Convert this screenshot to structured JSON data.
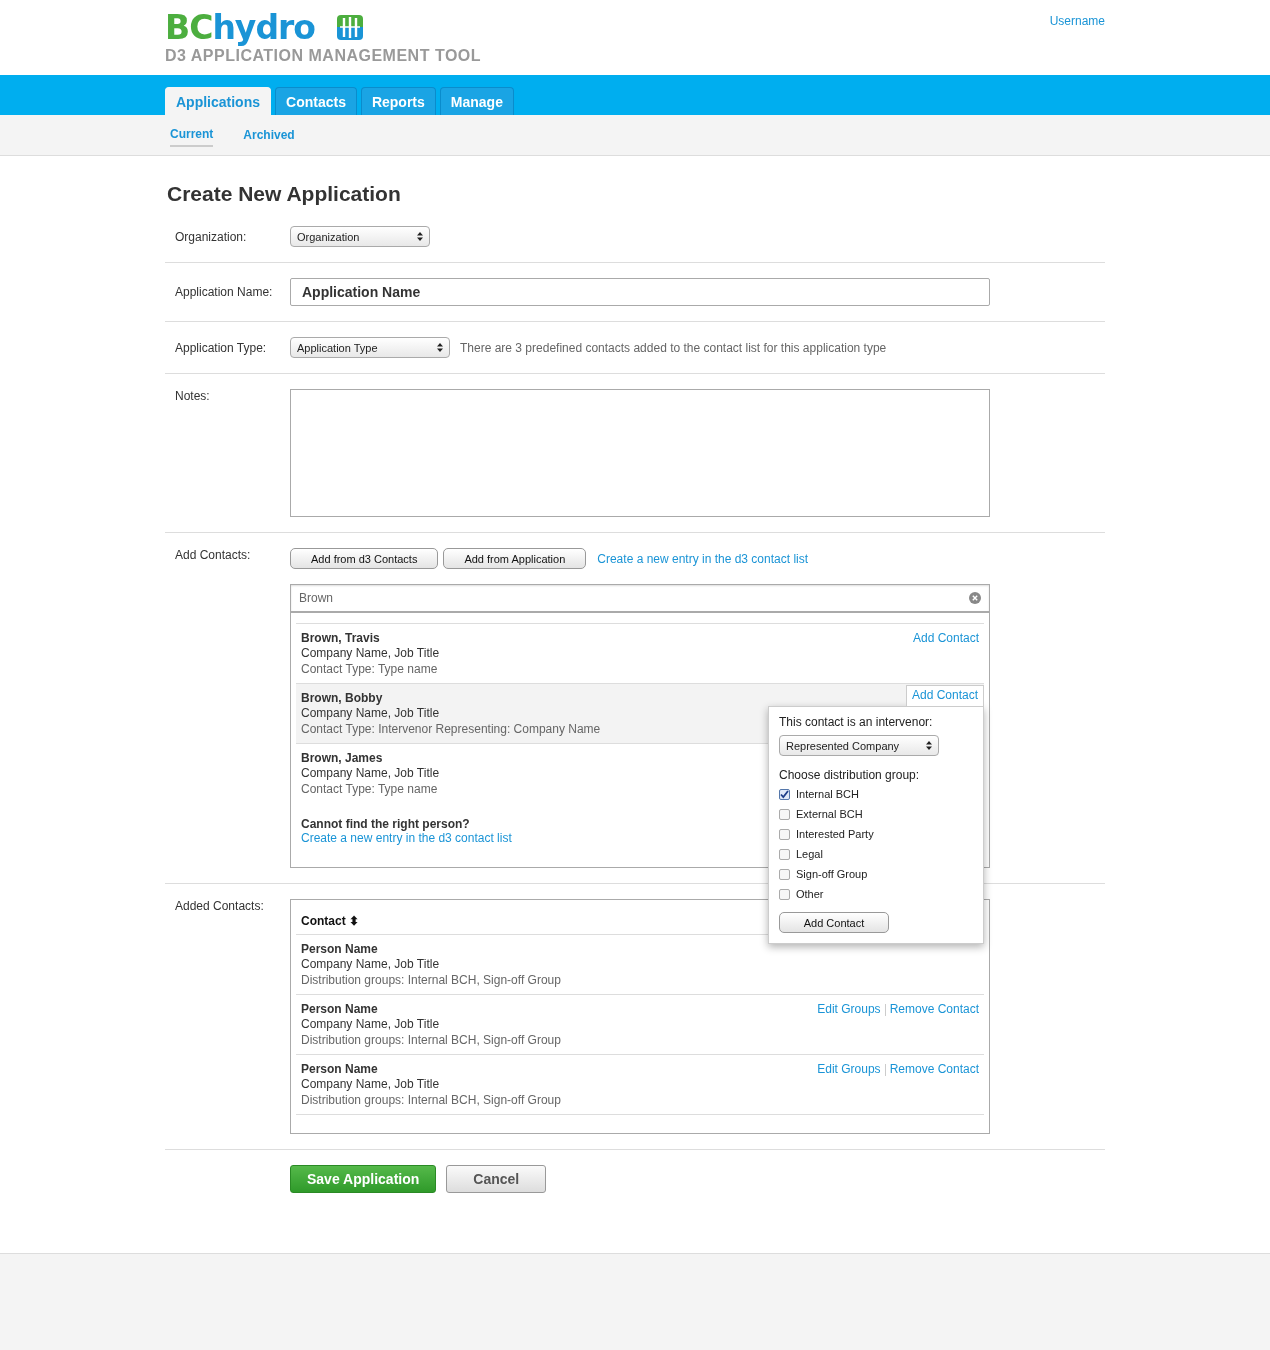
{
  "header": {
    "logo": {
      "part_1": "BC",
      "part_2": "hydro"
    },
    "app_title": "D3 APPLICATION MANAGEMENT TOOL",
    "user": "Username"
  },
  "tabs": [
    {
      "label": "Applications",
      "selected": true
    },
    {
      "label": "Contacts",
      "selected": false
    },
    {
      "label": "Reports",
      "selected": false
    },
    {
      "label": "Manage",
      "selected": false
    }
  ],
  "subnav": [
    {
      "label": "Current",
      "selected": true
    },
    {
      "label": "Archived",
      "selected": false
    }
  ],
  "page_title": "Create New Application",
  "form": {
    "organization": {
      "label": "Organization:",
      "value": "Organization"
    },
    "application_name": {
      "label": "Application Name:",
      "placeholder": "Application Name"
    },
    "application_type": {
      "label": "Application Type:",
      "value": "Application Type",
      "hint": "There are 3 predefined contacts added to the contact list for this application type"
    },
    "notes": {
      "label": "Notes:"
    },
    "add_contacts": {
      "label": "Add Contacts:",
      "buttons": [
        "Add from d3 Contacts",
        "Add from Application"
      ],
      "create_link": "Create a new entry in the d3 contact list",
      "search": {
        "value": "Brown"
      },
      "results": [
        {
          "name": "Brown, Travis",
          "company": "Company Name, Job Title",
          "type": "Contact Type: Type name",
          "action": "Add Contact",
          "selected": false
        },
        {
          "name": "Brown, Bobby",
          "company": "Company Name, Job Title",
          "type": "Contact Type: Intervenor Representing: Company Name",
          "action": "Add Contact",
          "selected": true
        },
        {
          "name": "Brown, James",
          "company": "Company Name, Job Title",
          "type": "Contact Type: Type name",
          "selected": false
        }
      ],
      "not_found": {
        "question": "Cannot find the right person?",
        "link": "Create a new entry in the d3 contact list"
      },
      "popover": {
        "intervenor_label": "This contact is an intervenor:",
        "intervenor_value": "Represented Company",
        "group_label": "Choose distribution group:",
        "groups": [
          {
            "label": "Internal BCH",
            "checked": true
          },
          {
            "label": "External BCH",
            "checked": false
          },
          {
            "label": "Interested Party",
            "checked": false
          },
          {
            "label": "Legal",
            "checked": false
          },
          {
            "label": "Sign-off Group",
            "checked": false
          },
          {
            "label": "Other",
            "checked": false
          }
        ],
        "button": "Add Contact"
      }
    },
    "added_contacts": {
      "label": "Added Contacts:",
      "column": "Contact",
      "sort_icon": "⬍",
      "rows": [
        {
          "name": "Person Name",
          "company": "Company Name, Job Title",
          "groups": "Distribution groups: Internal BCH, Sign-off Group"
        },
        {
          "name": "Person Name",
          "company": "Company Name, Job Title",
          "groups": "Distribution groups: Internal BCH, Sign-off Group",
          "actions": [
            "Edit Groups",
            "Remove Contact"
          ]
        },
        {
          "name": "Person Name",
          "company": "Company Name, Job Title",
          "groups": "Distribution groups: Internal BCH, Sign-off Group",
          "actions": [
            "Edit Groups",
            "Remove Contact"
          ]
        }
      ]
    }
  },
  "actions": [
    {
      "label": "Save Application",
      "kind": "primary"
    },
    {
      "label": "Cancel",
      "kind": "secondary"
    }
  ]
}
